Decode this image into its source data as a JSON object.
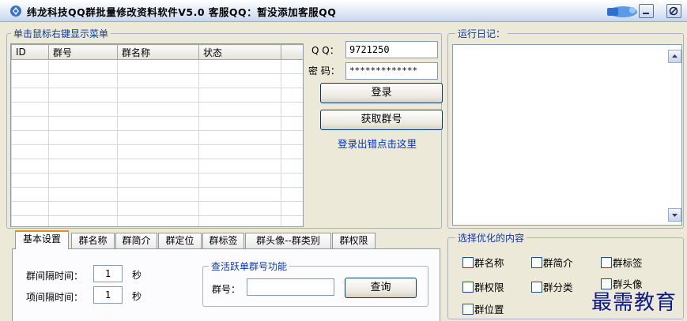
{
  "window": {
    "title": "纬龙科技QQ群批量修改资料软件V5.0   客服QQ：暂没添加客服QQ"
  },
  "colors": {
    "accent": "#0b38a6",
    "link": "#0033cc",
    "tab_highlight": "#e68b2c",
    "watermark": "#0a1a8c"
  },
  "group_list": {
    "legend": "单击鼠标右键显示菜单",
    "columns": [
      "ID",
      "群号",
      "群名称",
      "状态"
    ]
  },
  "login": {
    "qq_label": "Q  Q：",
    "qq_value": "9721250",
    "pwd_label": "密  码：",
    "pwd_value": "*************",
    "login_button": "登录",
    "get_groups_button": "获取群号",
    "help_link": "登录出错点击这里"
  },
  "log": {
    "legend": "运行日记："
  },
  "tabs": [
    "基本设置",
    "群名称",
    "群简介",
    "群定位",
    "群标签",
    "群头像--群类别",
    "群权限"
  ],
  "basic_settings": {
    "group_interval_label": "群间隔时间：",
    "group_interval_value": "1",
    "group_interval_unit": "秒",
    "item_interval_label": "项间隔时间：",
    "item_interval_value": "1",
    "item_interval_unit": "秒",
    "active_check_legend": "查活跃单群号功能",
    "group_no_label": "群号：",
    "group_no_value": "",
    "query_button": "查询"
  },
  "optimize": {
    "legend": "选择优化的内容",
    "options": [
      "群名称",
      "群简介",
      "群标签",
      "群权限",
      "群分类",
      "群头像",
      "群位置"
    ]
  },
  "watermark": "最需教育"
}
